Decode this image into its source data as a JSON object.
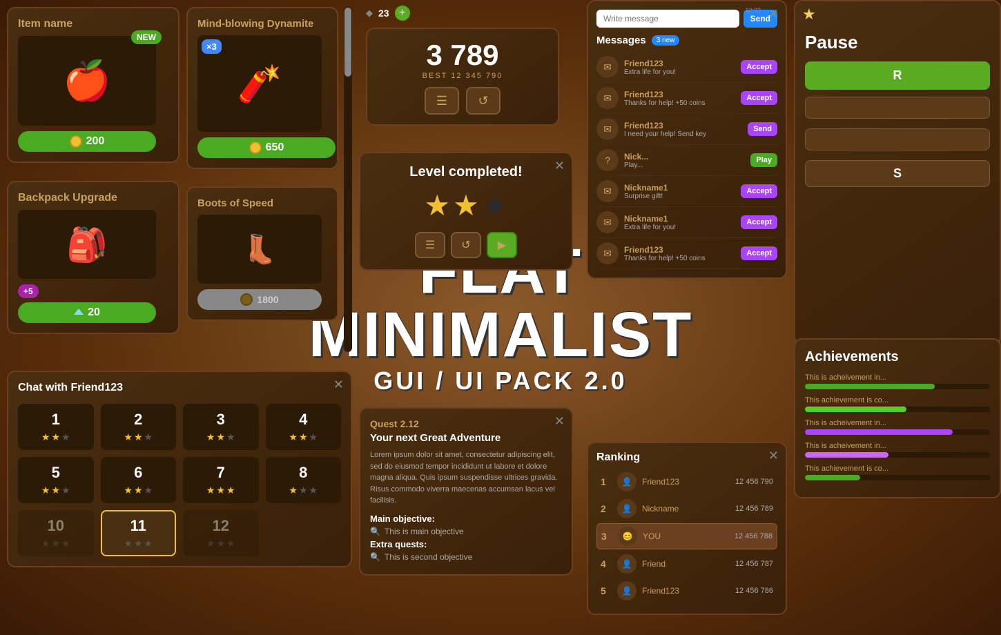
{
  "background": "#6b3a1f",
  "main_title": {
    "line1": "FLAT MINIMALIST",
    "line2": "GUI / UI PACK 2.0"
  },
  "item_card": {
    "title": "Item name",
    "new_badge": "NEW",
    "price": "200",
    "icon": "🍎"
  },
  "backpack_card": {
    "title": "Backpack Upgrade",
    "plus_badge": "+5",
    "price": "20",
    "icon": "🎒"
  },
  "dynamite_card": {
    "title": "Mind-blowing Dynamite",
    "multiplier": "×3",
    "price": "650",
    "icon": "🧨"
  },
  "boots_card": {
    "title": "Boots of Speed",
    "price": "1800",
    "icon": "👢"
  },
  "score_panel": {
    "value": "3 789",
    "best_label": "BEST 12 345 790",
    "btn_menu": "☰",
    "btn_refresh": "↺"
  },
  "level_complete": {
    "title": "Level completed!",
    "stars": [
      true,
      true,
      false
    ],
    "btn_menu": "☰",
    "btn_refresh": "↺",
    "btn_play": "▶"
  },
  "quest": {
    "id": "Quest 2.12",
    "subtitle": "Your next Great Adventure",
    "text": "Lorem ipsum dolor sit amet, consectetur adipiscing elit, sed do eiusmod tempor incididunt ut labore et dolore magna aliqua. Quis ipsum suspendisse ultrices gravida. Risus commodo viverra maecenas accumsan lacus vel facilisis.",
    "main_objective_label": "Main objective:",
    "main_objective": "This is main objective",
    "extra_quests_label": "Extra quests:",
    "extra_quest": "This is second objective"
  },
  "messages": {
    "title": "Messages",
    "new_count": "3 new",
    "write_placeholder": "Write message",
    "send_label": "Send",
    "timestamp1": "12:33",
    "timestamp2": "12:33",
    "items": [
      {
        "sender": "Friend123",
        "text": "Extra life for you!",
        "action": "Accept"
      },
      {
        "sender": "Friend123",
        "text": "Thanks for help! +50 coins",
        "action": "Accept"
      },
      {
        "sender": "Friend123",
        "text": "I need your help! Send key",
        "action": "Send"
      },
      {
        "sender": "Nick...",
        "text": "Play...",
        "action": "Play"
      },
      {
        "sender": "Nickname1",
        "text": "Surprise gift!",
        "action": "Accept"
      },
      {
        "sender": "Nickname1",
        "text": "Extra life for you!",
        "action": "Accept"
      },
      {
        "sender": "Friend123",
        "text": "Thanks for help! +50 coins",
        "action": "Accept"
      }
    ]
  },
  "ranking": {
    "title": "Ranking",
    "items": [
      {
        "rank": 1,
        "name": "Friend123",
        "score": "12 456 790"
      },
      {
        "rank": 2,
        "name": "Nickname",
        "score": "12 456 789"
      },
      {
        "rank": 3,
        "name": "YOU",
        "score": "12 456 788",
        "highlight": true
      },
      {
        "rank": 4,
        "name": "Friend",
        "score": "12 456 787"
      },
      {
        "rank": 5,
        "name": "Friend123",
        "score": "12 456 786"
      }
    ]
  },
  "pause": {
    "title": "Pause",
    "resume_label": "R",
    "star_icon": "★"
  },
  "achievements": {
    "title": "Achievements",
    "items": [
      {
        "text": "This is acheivement in...",
        "fill": 70,
        "color": "bar-green"
      },
      {
        "text": "This achievement is co...",
        "fill": 55,
        "color": "bar-green2"
      },
      {
        "text": "This is acheivement in...",
        "fill": 80,
        "color": "bar-purple"
      },
      {
        "text": "This is acheivement in...",
        "fill": 45,
        "color": "bar-purple2"
      },
      {
        "text": "This achievement is co...",
        "fill": 30,
        "color": "bar-green"
      }
    ]
  },
  "chat": {
    "title": "Chat with Friend123",
    "levels": [
      {
        "num": "1",
        "stars": [
          true,
          true,
          false
        ]
      },
      {
        "num": "2",
        "stars": [
          true,
          true,
          false
        ]
      },
      {
        "num": "3",
        "stars": [
          true,
          true,
          false
        ]
      },
      {
        "num": "4",
        "stars": [
          true,
          true,
          false
        ]
      },
      {
        "num": "5",
        "stars": [
          true,
          true,
          false
        ]
      },
      {
        "num": "6",
        "stars": [
          true,
          true,
          false
        ]
      },
      {
        "num": "7",
        "stars": [
          true,
          true,
          false
        ]
      },
      {
        "num": "8",
        "stars": [
          true,
          false,
          false
        ]
      },
      {
        "num": "10",
        "stars": [
          false,
          false,
          false
        ],
        "locked": true
      },
      {
        "num": "11",
        "stars": [
          false,
          false,
          false
        ],
        "active": true
      },
      {
        "num": "12",
        "stars": [
          false,
          false,
          false
        ],
        "locked": true
      }
    ]
  },
  "top_counter": {
    "value": "23"
  }
}
